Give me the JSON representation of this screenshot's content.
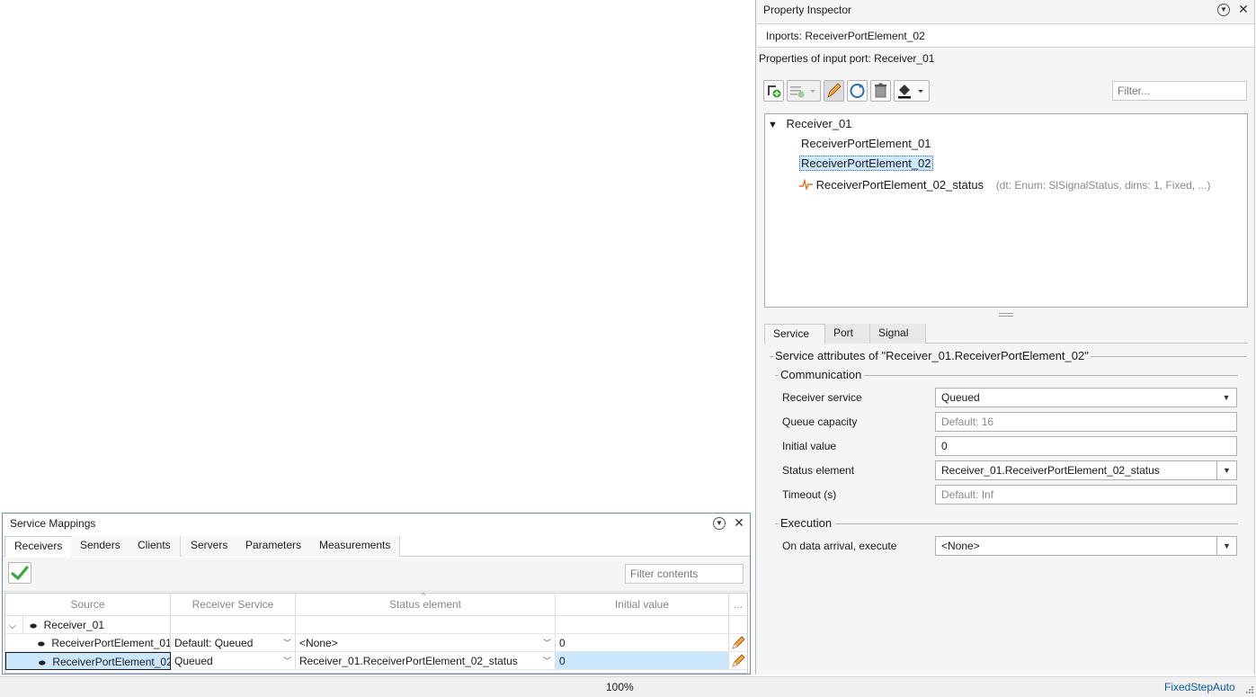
{
  "service_mappings": {
    "title": "Service Mappings",
    "tabs": [
      "Receivers",
      "Senders",
      "Clients",
      "Servers",
      "Parameters",
      "Measurements"
    ],
    "active_tab": "Receivers",
    "filter_placeholder": "Filter contents",
    "columns": [
      "Source",
      "Receiver Service",
      "Status element",
      "Initial value",
      "..."
    ],
    "group_row": "Receiver_01",
    "rows": [
      {
        "source": "ReceiverPortElement_01",
        "service": "Default: Queued",
        "status": "<None>",
        "initial": "0"
      },
      {
        "source": "ReceiverPortElement_02",
        "service": "Queued",
        "status": "Receiver_01.ReceiverPortElement_02_status",
        "initial": "0",
        "selected": true
      }
    ]
  },
  "property_inspector": {
    "title": "Property Inspector",
    "subtitle": "Inports: ReceiverPortElement_02",
    "properties_of": "Properties of input port: Receiver_01",
    "filter_placeholder": "Filter...",
    "tree": {
      "root": "Receiver_01",
      "children": [
        "ReceiverPortElement_01",
        "ReceiverPortElement_02"
      ],
      "signal": "ReceiverPortElement_02_status",
      "signal_detail": "(dt: Enum: SlSignalStatus, dims: 1, Fixed, ...)"
    },
    "tabs": [
      "Service",
      "Port",
      "Signal"
    ],
    "active_tab": "Service",
    "service_group": "Service attributes of \"Receiver_01.ReceiverPortElement_02\"",
    "communication": {
      "title": "Communication",
      "receiver_service_label": "Receiver service",
      "receiver_service_value": "Queued",
      "queue_capacity_label": "Queue capacity",
      "queue_capacity_placeholder": "Default: 16",
      "initial_value_label": "Initial value",
      "initial_value_value": "0",
      "status_element_label": "Status element",
      "status_element_value": "Receiver_01.ReceiverPortElement_02_status",
      "timeout_label": "Timeout (s)",
      "timeout_placeholder": "Default: Inf"
    },
    "execution": {
      "title": "Execution",
      "on_data_arrival_label": "On data arrival, execute",
      "on_data_arrival_value": "<None>"
    }
  },
  "status_bar": {
    "zoom": "100%",
    "solver": "FixedStepAuto"
  },
  "colors": {
    "selection": "#cce8ff",
    "signal_icon": "#e07020",
    "check_icon": "#3aa83a",
    "pencil": "#e07a1a",
    "solver_link": "#0b5aa8"
  }
}
